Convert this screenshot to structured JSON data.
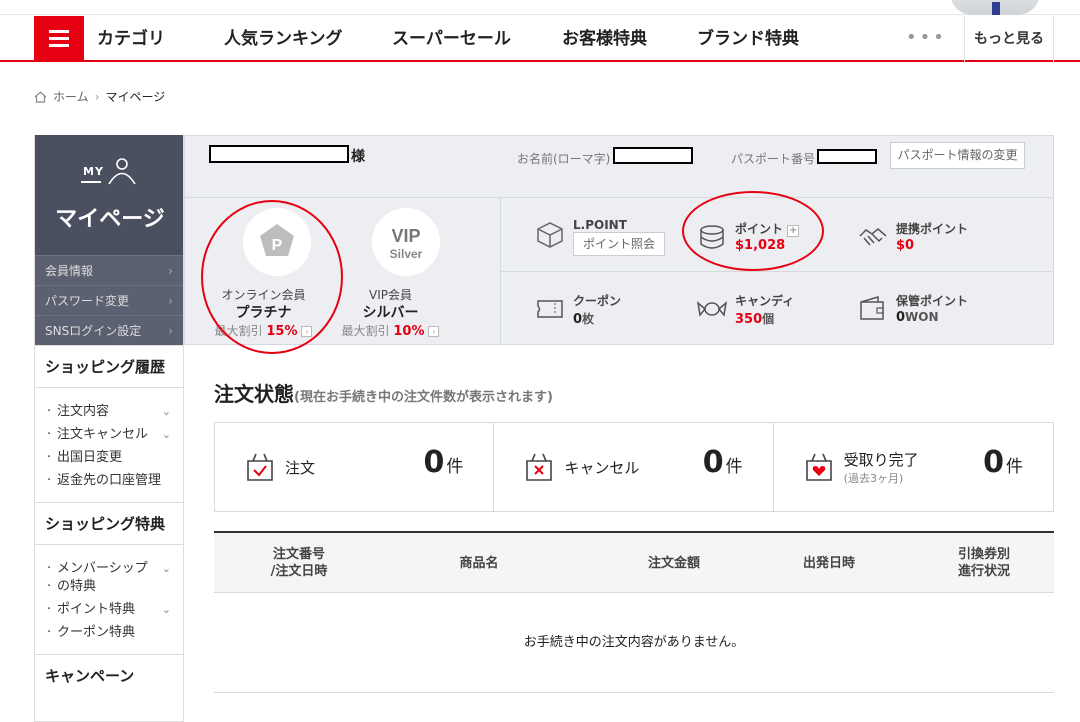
{
  "header": {
    "nav": [
      "カテゴリ",
      "人気ランキング",
      "スーパーセール",
      "お客様特典",
      "ブランド特典"
    ],
    "dots": "•••",
    "more": "もっと見る"
  },
  "breadcrumb": {
    "home": "ホーム",
    "sep": "›",
    "current": "マイページ"
  },
  "sidebar": {
    "my": "MY",
    "title": "マイページ",
    "account_items": [
      {
        "label": "会員情報",
        "arrow": "›"
      },
      {
        "label": "パスワード変更",
        "arrow": "›"
      },
      {
        "label": "SNSログイン設定",
        "arrow": "›"
      }
    ],
    "sections": [
      {
        "title": "ショッピング履歴",
        "items": [
          {
            "label": "注文内容",
            "chev": "⌄"
          },
          {
            "label": "注文キャンセル",
            "chev": "⌄"
          },
          {
            "label": "出国日変更",
            "chev": ""
          },
          {
            "label": "返金先の口座管理",
            "chev": ""
          }
        ]
      },
      {
        "title": "ショッピング特典",
        "items": [
          {
            "label": "メンバーシップ",
            "chev": "⌄"
          },
          {
            "label": "の特典",
            "chev": ""
          },
          {
            "label": "ポイント特典",
            "chev": "⌄"
          },
          {
            "label": "クーポン特典",
            "chev": ""
          }
        ]
      },
      {
        "title": "キャンペーン",
        "items": []
      }
    ]
  },
  "member": {
    "honorific": "様",
    "roman_name_label": "お名前(ローマ字)",
    "passport_label": "パスポート番号",
    "passport_button": "パスポート情報の変更",
    "online": {
      "caption": "オンライン会員",
      "grade": "プラチナ",
      "discount_label": "最大割引",
      "discount": "15%",
      "badge_letter": "P"
    },
    "vip": {
      "caption": "VIP会員",
      "grade": "シルバー",
      "discount_label": "最大割引",
      "discount": "10%",
      "badge_top": "VIP",
      "badge_bottom": "Silver"
    },
    "lpoint": {
      "name": "L.POINT",
      "button": "ポイント照会"
    },
    "point": {
      "name": "ポイント",
      "value": "$1,028",
      "plus": "+"
    },
    "partner": {
      "name": "提携ポイント",
      "value": "$0"
    },
    "coupon": {
      "name": "クーポン",
      "value": "0",
      "unit": "枚"
    },
    "candy": {
      "name": "キャンディ",
      "value": "350",
      "unit": "個"
    },
    "stored": {
      "name": "保管ポイント",
      "value": "0",
      "unit": "WON"
    }
  },
  "order_status": {
    "title": "注文状態",
    "subtitle": "(現在お手続き中の注文件数が表示されます)",
    "cells": [
      {
        "name": "注文",
        "count": "0",
        "unit": "件"
      },
      {
        "name": "キャンセル",
        "count": "0",
        "unit": "件"
      },
      {
        "name": "受取り完了",
        "sub": "(過去3ヶ月)",
        "count": "0",
        "unit": "件"
      }
    ]
  },
  "table": {
    "headers": [
      "注文番号\n/注文日時",
      "商品名",
      "注文金額",
      "出発日時",
      "引換券別\n進行状況"
    ],
    "empty": "お手続き中の注文内容がありません。"
  },
  "colors": {
    "accent": "#e60012",
    "sidebar": "#4a5060",
    "panel": "#eceef2"
  }
}
